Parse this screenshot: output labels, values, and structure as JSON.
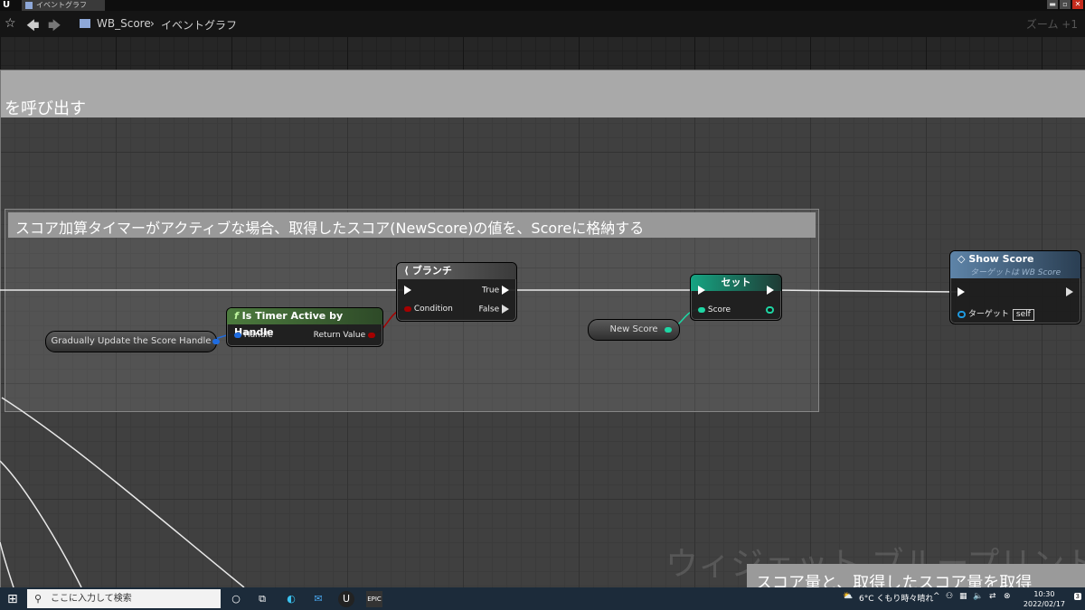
{
  "window": {
    "tab_label": "イベントグラフ",
    "logo": "U",
    "minimize": "▬",
    "restore": "▫",
    "close": "✕"
  },
  "toolbar": {
    "breadcrumb_root": "WB_Score",
    "breadcrumb_sep": "›",
    "breadcrumb_current": "イベントグラフ",
    "zoom": "ズーム +1"
  },
  "comments": {
    "outer_title": "を呼び出す",
    "inner_title": "スコア加算タイマーがアクティブな場合、取得したスコア(NewScore)の値を、Scoreに格納する",
    "bottom_title": "スコア量と、取得したスコア量を取得",
    "watermark": "ウィジェット ブループリント"
  },
  "nodes": {
    "handle_var": {
      "label": "Gradually Update the Score Handle"
    },
    "timer": {
      "title": "Is Timer Active by Handle",
      "fn_icon": "f",
      "in_pin": "Handle",
      "out_pin": "Return Value"
    },
    "branch": {
      "title": "ブランチ",
      "condition": "Condition",
      "true": "True",
      "false": "False"
    },
    "new_score_var": {
      "label": "New Score"
    },
    "set": {
      "title": "セット",
      "pin": "Score"
    },
    "show_score": {
      "title": "Show Score",
      "subtitle": "ターゲットは WB Score",
      "target": "ターゲット",
      "self": "self"
    }
  },
  "colors": {
    "timer_header": "#4c7a3e",
    "branch_header": "#5a5a5a",
    "show_header": "#5e84a8",
    "exec_wire": "#ffffff",
    "object_pin": "#1f6ce0",
    "bool_pin": "#a60000",
    "int_pin": "#1ed6a4"
  },
  "taskbar": {
    "search_placeholder": "ここに入力して検索",
    "weather": "6°C  くもり時々晴れ",
    "time": "10:30",
    "date": "2022/02/17",
    "epic": "EPIC",
    "notifications": "3"
  }
}
